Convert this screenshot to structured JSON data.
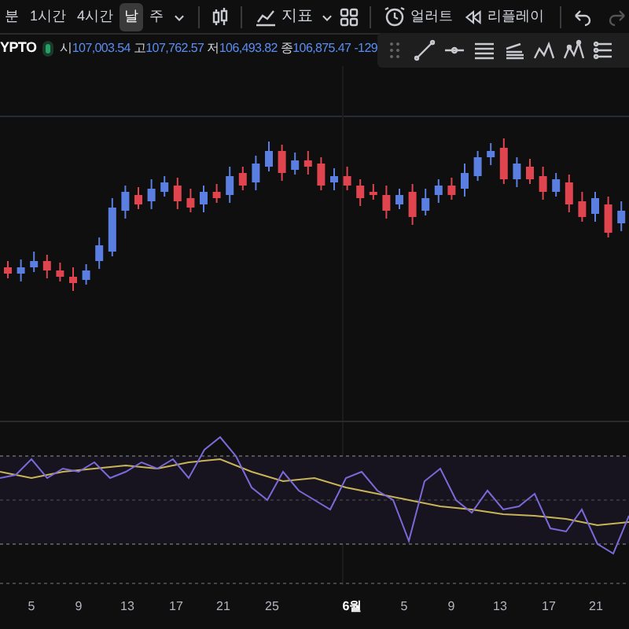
{
  "toolbar": {
    "timeframes": [
      {
        "label": "분",
        "selected": false
      },
      {
        "label": "1시간",
        "selected": false
      },
      {
        "label": "4시간",
        "selected": false
      },
      {
        "label": "날",
        "selected": true
      },
      {
        "label": "주",
        "selected": false
      }
    ],
    "indicators_label": "지표",
    "alert_label": "얼러트",
    "replay_label": "리플레이"
  },
  "symbol": {
    "name": "YPTO",
    "ohlc": [
      {
        "label": "시",
        "value": "107,003.54"
      },
      {
        "label": "고",
        "value": "107,762.57"
      },
      {
        "label": "저",
        "value": "106,493.82"
      },
      {
        "label": "종",
        "value": "106,875.47"
      }
    ],
    "change": "-129"
  },
  "x_axis": {
    "labels": [
      "5",
      "9",
      "13",
      "17",
      "21",
      "25",
      "6월",
      "5",
      "9",
      "13",
      "17",
      "21"
    ]
  }
}
